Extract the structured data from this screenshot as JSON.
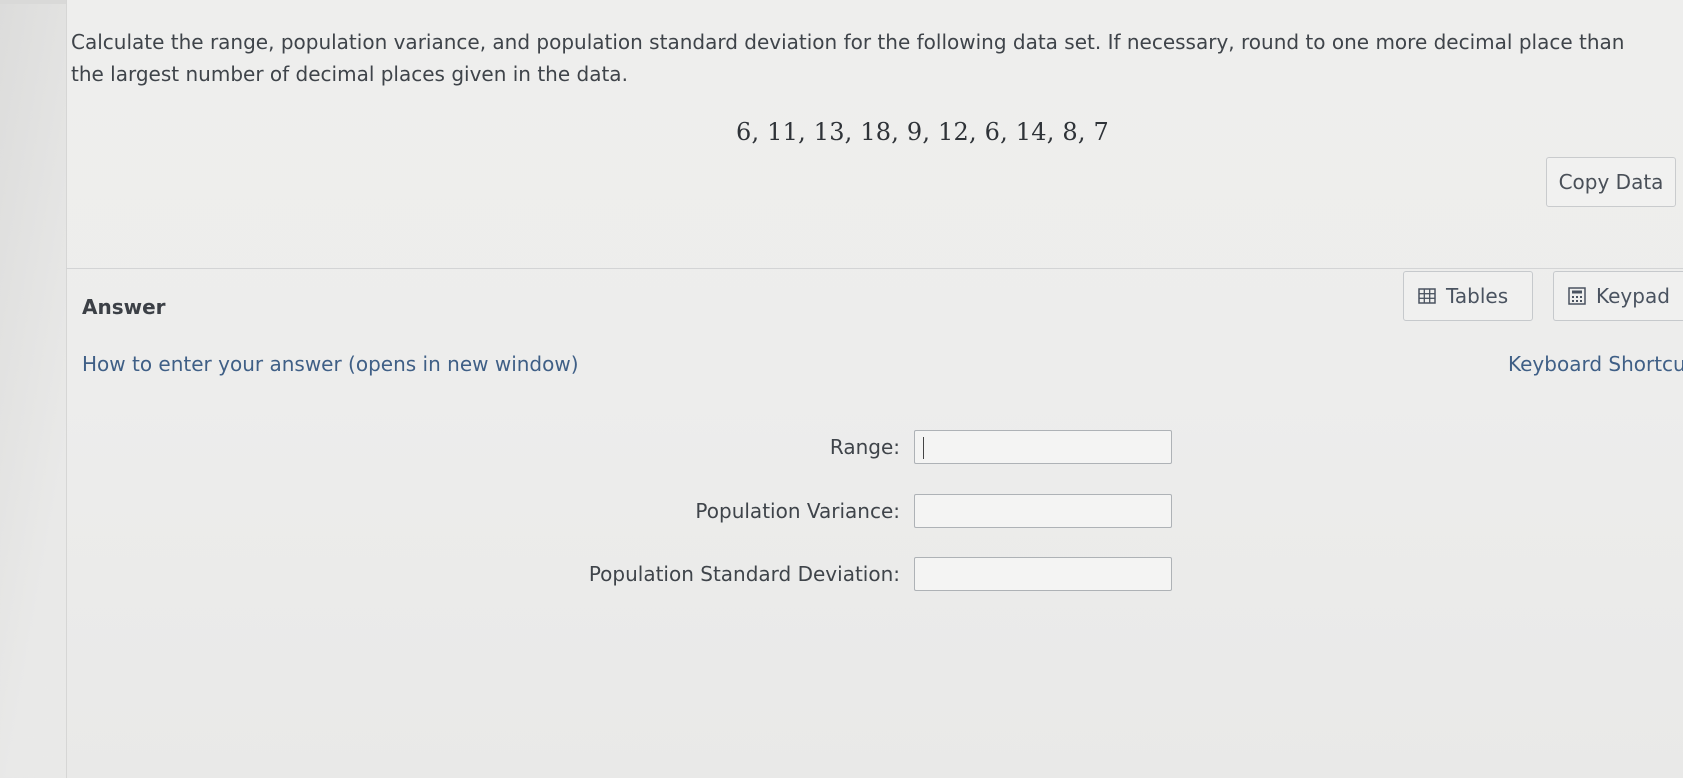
{
  "question": {
    "prompt": "Calculate the range, population variance, and population standard deviation for the following data set. If necessary, round to one more decimal place than the largest number of decimal places given in the data.",
    "dataset": "6, 11, 13, 18, 9, 12, 6, 14, 8, 7"
  },
  "toolbar": {
    "copy_data_label": "Copy Data",
    "tables_label": "Tables",
    "keypad_label": "Keypad",
    "keyboard_shortcuts_label": "Keyboard Shortcuts",
    "tables_icon": "table-grid-icon",
    "keypad_icon": "calculator-icon"
  },
  "answer": {
    "title": "Answer",
    "how_to_link": "How to enter your answer (opens in new window)",
    "fields": [
      {
        "label": "Range:",
        "value": ""
      },
      {
        "label": "Population Variance:",
        "value": ""
      },
      {
        "label": "Population Standard Deviation:",
        "value": ""
      }
    ]
  },
  "colors": {
    "link": "#3f5f86",
    "border": "#c6c9cc",
    "background": "#ededec"
  }
}
